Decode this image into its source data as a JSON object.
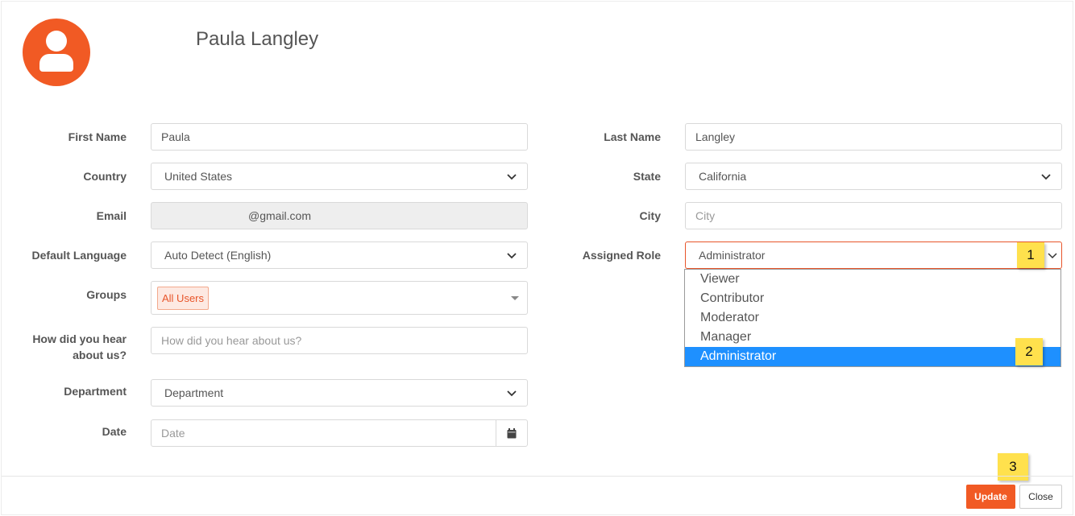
{
  "profile": {
    "name": "Paula Langley"
  },
  "form": {
    "first_name": {
      "label": "First Name",
      "value": "Paula"
    },
    "last_name": {
      "label": "Last Name",
      "value": "Langley"
    },
    "country": {
      "label": "Country",
      "value": "United States"
    },
    "state": {
      "label": "State",
      "value": "California"
    },
    "email": {
      "label": "Email",
      "value": "@gmail.com"
    },
    "city": {
      "label": "City",
      "placeholder": "City"
    },
    "default_language": {
      "label": "Default Language",
      "value": "Auto Detect (English)"
    },
    "assigned_role": {
      "label": "Assigned Role",
      "value": "Administrator",
      "options": [
        "Viewer",
        "Contributor",
        "Moderator",
        "Manager",
        "Administrator"
      ],
      "selected_index": 4
    },
    "groups": {
      "label": "Groups",
      "chips": [
        "All Users"
      ]
    },
    "how_heard": {
      "label_line1": "How did you hear",
      "label_line2": "about us?",
      "placeholder": "How did you hear about us?"
    },
    "department": {
      "label": "Department",
      "value": "Department"
    },
    "date": {
      "label": "Date",
      "placeholder": "Date"
    }
  },
  "annotations": {
    "badge1": "1",
    "badge2": "2",
    "badge3": "3"
  },
  "footer": {
    "update_label": "Update",
    "close_label": "Close"
  },
  "colors": {
    "accent": "#f15a24",
    "selected_option": "#1e90ff",
    "badge": "#ffe14d"
  }
}
